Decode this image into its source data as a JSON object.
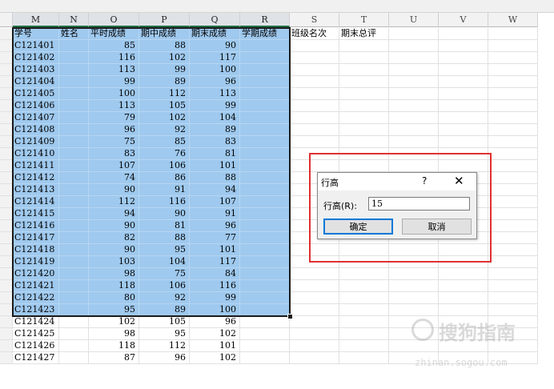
{
  "columns": [
    "M",
    "N",
    "O",
    "P",
    "Q",
    "R",
    "S",
    "T",
    "U",
    "V",
    "W"
  ],
  "selected_columns": [
    "M",
    "N",
    "O",
    "P",
    "Q",
    "R"
  ],
  "header_row": [
    "学号",
    "姓名",
    "平时成绩",
    "期中成绩",
    "期末成绩",
    "学期成绩",
    "班级名次",
    "期末总评"
  ],
  "rows": [
    [
      "C121401",
      "85",
      "88",
      "90"
    ],
    [
      "C121402",
      "116",
      "102",
      "117"
    ],
    [
      "C121403",
      "113",
      "99",
      "100"
    ],
    [
      "C121404",
      "99",
      "89",
      "96"
    ],
    [
      "C121405",
      "100",
      "112",
      "113"
    ],
    [
      "C121406",
      "113",
      "105",
      "99"
    ],
    [
      "C121407",
      "79",
      "102",
      "104"
    ],
    [
      "C121408",
      "96",
      "92",
      "89"
    ],
    [
      "C121409",
      "75",
      "85",
      "83"
    ],
    [
      "C121410",
      "83",
      "76",
      "81"
    ],
    [
      "C121411",
      "107",
      "106",
      "101"
    ],
    [
      "C121412",
      "74",
      "86",
      "88"
    ],
    [
      "C121413",
      "90",
      "91",
      "94"
    ],
    [
      "C121414",
      "112",
      "116",
      "107"
    ],
    [
      "C121415",
      "94",
      "90",
      "91"
    ],
    [
      "C121416",
      "90",
      "81",
      "96"
    ],
    [
      "C121417",
      "82",
      "88",
      "77"
    ],
    [
      "C121418",
      "90",
      "95",
      "101"
    ],
    [
      "C121419",
      "103",
      "104",
      "117"
    ],
    [
      "C121420",
      "98",
      "75",
      "84"
    ],
    [
      "C121421",
      "118",
      "106",
      "116"
    ],
    [
      "C121422",
      "80",
      "92",
      "99"
    ],
    [
      "C121423",
      "95",
      "89",
      "100"
    ],
    [
      "C121424",
      "102",
      "105",
      "96"
    ],
    [
      "C121425",
      "98",
      "95",
      "102"
    ],
    [
      "C121426",
      "118",
      "112",
      "101"
    ],
    [
      "C121427",
      "87",
      "96",
      "102"
    ]
  ],
  "selected_row_count": 24,
  "dialog": {
    "title": "行高",
    "help": "?",
    "close": "✕",
    "label": "行高(R):",
    "value": "15",
    "ok": "确定",
    "cancel": "取消"
  },
  "watermark": {
    "brand": "搜狗指南",
    "url": "zhinan.sogou.com"
  },
  "colors": {
    "selection": "#9fc9ee",
    "highlight_box": "#e03030"
  }
}
